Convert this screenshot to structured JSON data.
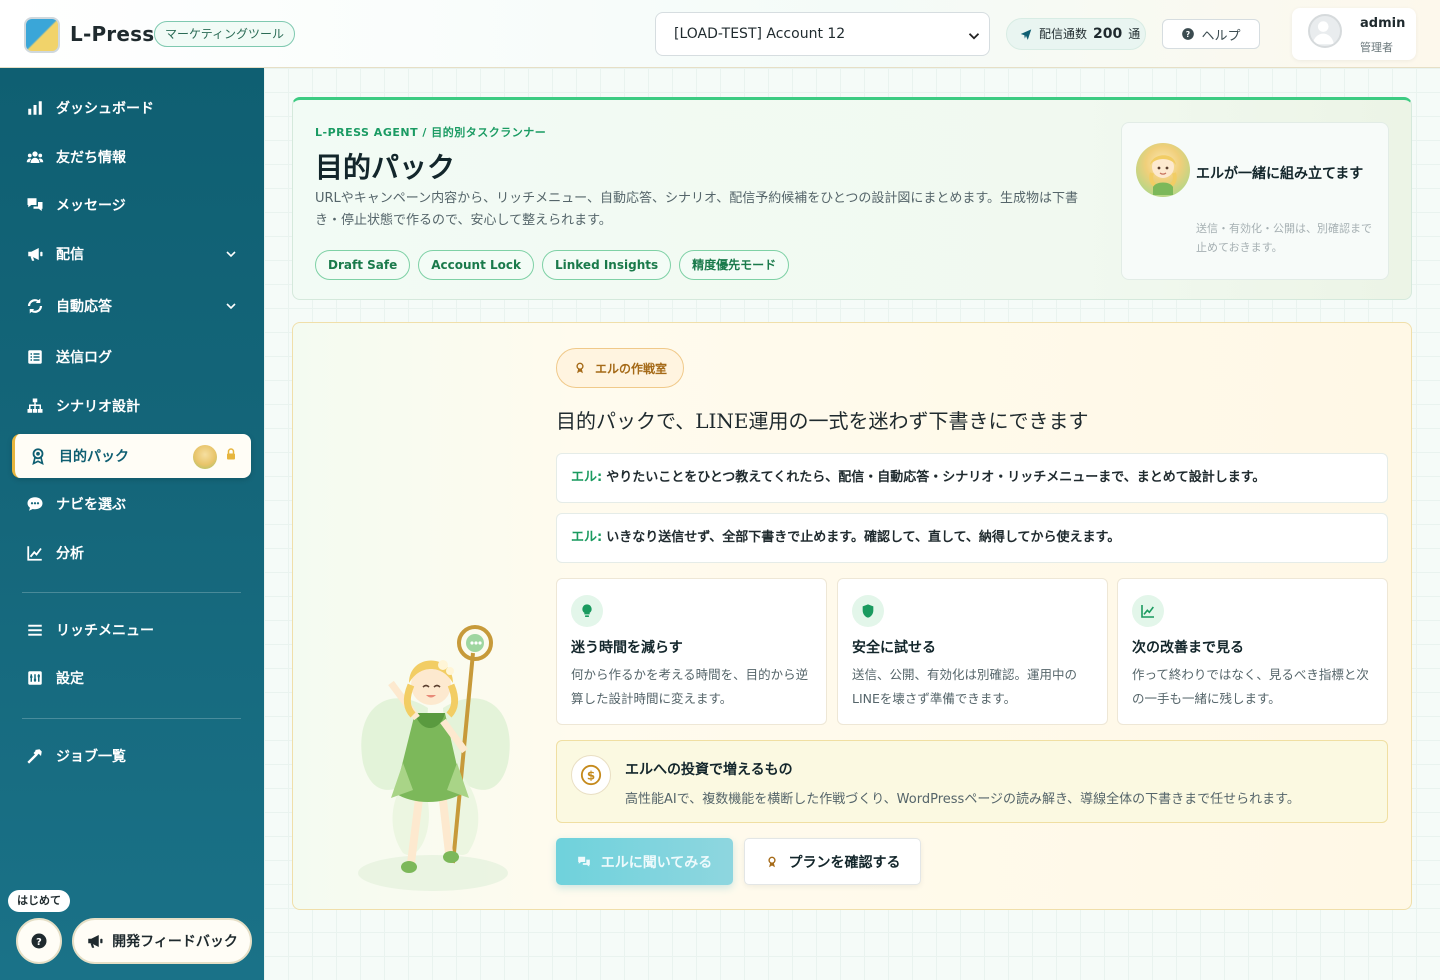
{
  "header": {
    "logo_text": "L-Press",
    "logo_badge": "マーケティングツール",
    "account": "[LOAD-TEST] Account 12",
    "send_count_label": "配信通数",
    "send_count_value": "200",
    "send_count_unit": "通",
    "help_label": "ヘルプ",
    "user_name": "admin",
    "user_role": "管理者"
  },
  "sidebar": {
    "items": [
      {
        "label": "ダッシュボード",
        "icon": "bar-chart-icon"
      },
      {
        "label": "友だち情報",
        "icon": "users-icon"
      },
      {
        "label": "メッセージ",
        "icon": "chat-icon"
      },
      {
        "label": "配信",
        "icon": "megaphone-icon"
      },
      {
        "label": "自動応答",
        "icon": "sync-icon"
      },
      {
        "label": "送信ログ",
        "icon": "list-icon"
      },
      {
        "label": "シナリオ設計",
        "icon": "sitemap-icon"
      },
      {
        "label": "目的パック",
        "icon": "award-icon"
      },
      {
        "label": "ナビを選ぶ",
        "icon": "comment-dots-icon"
      },
      {
        "label": "分析",
        "icon": "line-chart-icon"
      },
      {
        "label": "リッチメニュー",
        "icon": "menu-icon"
      },
      {
        "label": "設定",
        "icon": "settings-icon"
      },
      {
        "label": "ジョブ一覧",
        "icon": "hammer-icon"
      }
    ],
    "hajimete": "はじめて",
    "feedback": "開発フィードバック"
  },
  "hero": {
    "eyebrow": "L-PRESS AGENT / 目的別タスクランナー",
    "title": "目的パック",
    "description": "URLやキャンペーン内容から、リッチメニュー、自動応答、シナリオ、配信予約候補をひとつの設計図にまとめます。生成物は下書き・停止状態で作るので、安心して整えられます。",
    "tags": [
      "Draft Safe",
      "Account Lock",
      "Linked Insights",
      "精度優先モード"
    ],
    "card_title": "エルが一緒に組み立てます",
    "card_note": "送信・有効化・公開は、別確認まで止めておきます。"
  },
  "panel": {
    "room_label": "エルの作戦室",
    "title": "目的パックで、LINE運用の一式を迷わず下書きにできます",
    "messages": [
      {
        "who": "エル:",
        "text": "やりたいことをひとつ教えてくれたら、配信・自動応答・シナリオ・リッチメニューまで、まとめて設計します。"
      },
      {
        "who": "エル:",
        "text": "いきなり送信せず、全部下書きで止めます。確認して、直して、納得してから使えます。"
      }
    ],
    "features": [
      {
        "title": "迷う時間を減らす",
        "desc": "何から作るかを考える時間を、目的から逆算した設計時間に変えます。",
        "icon": "lightbulb-icon"
      },
      {
        "title": "安全に試せる",
        "desc": "送信、公開、有効化は別確認。運用中のLINEを壊さず準備できます。",
        "icon": "shield-icon"
      },
      {
        "title": "次の改善まで見る",
        "desc": "作って終わりではなく、見るべき指標と次の一手も一緒に残します。",
        "icon": "trend-chart-icon"
      }
    ],
    "invest_title": "エルへの投資で増えるもの",
    "invest_desc": "高性能AIで、複数機能を横断した作戦づくり、WordPressページの読み解き、導線全体の下書きまで任せられます。",
    "ask_button": "エルに聞いてみる",
    "plan_button": "プランを確認する"
  }
}
